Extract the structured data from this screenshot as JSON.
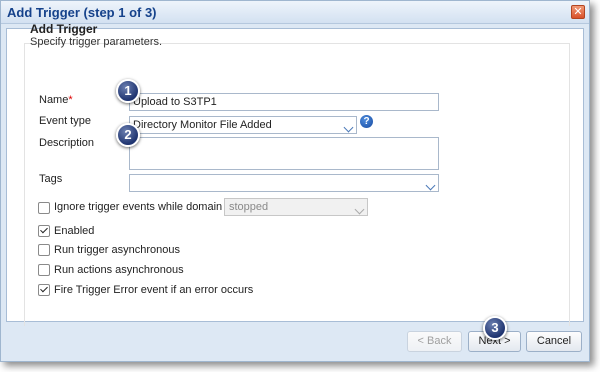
{
  "window": {
    "title": "Add Trigger (step 1 of 3)",
    "close_glyph": "✕"
  },
  "section": {
    "title": "Add Trigger",
    "subtitle": "Specify trigger parameters."
  },
  "form": {
    "name_label": "Name",
    "name_required_mark": "*",
    "name_value": "Upload to S3TP1",
    "event_type_label": "Event type",
    "event_type_value": "Directory Monitor File Added",
    "description_label": "Description",
    "description_value": "",
    "tags_label": "Tags",
    "tags_value": "",
    "ignore_label": "Ignore trigger events while domain is",
    "ignore_checked": false,
    "domain_state_value": "stopped",
    "help_glyph": "?"
  },
  "checkboxes": [
    {
      "label": "Enabled",
      "checked": true
    },
    {
      "label": "Run trigger asynchronous",
      "checked": false
    },
    {
      "label": "Run actions asynchronous",
      "checked": false
    },
    {
      "label": "Fire Trigger Error event if an error occurs",
      "checked": true
    }
  ],
  "buttons": {
    "back": "< Back",
    "next": "Next >",
    "cancel": "Cancel"
  },
  "callouts": [
    "1",
    "2",
    "3"
  ]
}
